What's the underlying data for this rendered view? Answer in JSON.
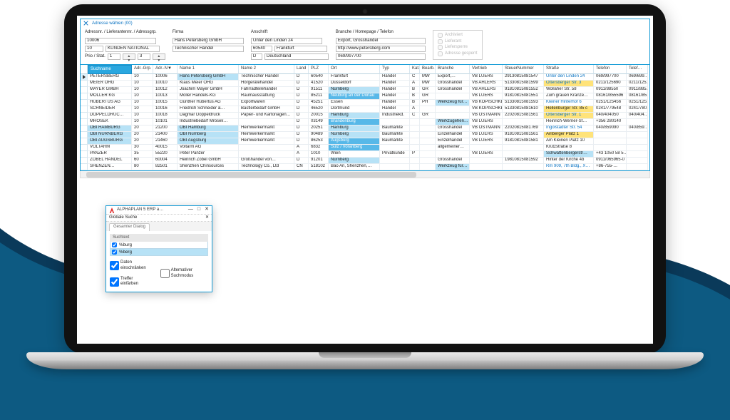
{
  "window": {
    "title": "Adresse wählen (00)"
  },
  "form": {
    "adr_label": "Adressnr. / Lieferantennr. / Adressgrp.",
    "adr_nr": "10006",
    "adr_grp_nr": "10",
    "adr_grp_name": "KUNDEN NATIONAL",
    "prio_label": "Prio / Stat.",
    "prio": "1",
    "stat": "3",
    "firma_label": "Firma",
    "firma1": "Hans Petersberg GmbH",
    "firma2": "Technischer Handel",
    "anschrift_label": "Anschrift",
    "street": "Unter den Linden 24",
    "plz": "60540",
    "ort": "Frankfurt",
    "land": "D",
    "land2": "Deutschland",
    "branche_label": "Branche / Homepage / Telefon",
    "branche": "Export, Grosshandel",
    "homepage": "http://www.petersberg.com",
    "tel": "069/997700",
    "chk_archiviert": "Archiviert",
    "chk_lieferant": "Lieferant",
    "chk_liefersperre": "Liefersperre",
    "chk_adressgesperrt": "Adresse gesperrt"
  },
  "grid": {
    "headers": {
      "suchname": "Suchname",
      "grp": "Adr.-Grp. ▲",
      "nr": "Adr.-N▼",
      "n1": "Name 1",
      "n2": "Name 2",
      "land": "Land",
      "plz": "PLZ",
      "ort": "Ort",
      "typ": "Typ",
      "kat": "Kat.",
      "bearb": "Bearb.",
      "branche": "Branche",
      "vertr": "Vertrieb",
      "steuer": "SteuerNummer",
      "str": "Straße",
      "tel": "Telefon",
      "tel2": "Telef…"
    },
    "rows": [
      {
        "such": "PETERSBERG",
        "grp": "10",
        "nr": "10006",
        "n1": "Hans Petersberg GmbH",
        "n2": "Technischer Handel",
        "land": "D",
        "plz": "60540",
        "ort": "Frankfurt",
        "typ": "Handel",
        "kat": "C",
        "bearb": "MW",
        "branche": "Export,…",
        "vertr": "VB LÜERS",
        "steuer": "29130815081547",
        "str": "Unter den Linden 24",
        "tel": "069/997700",
        "tel2": "069/699…",
        "sel": true,
        "hl_n1": "lt",
        "str_link": true
      },
      {
        "such": "MEIER OHG",
        "grp": "10",
        "nr": "10010",
        "n1": "Klaus Meier OHG",
        "n2": "Hörgerätehandel",
        "land": "D",
        "plz": "41520",
        "ort": "Düsseldorf",
        "typ": "Handel",
        "kat": "A",
        "bearb": "MW",
        "branche": "Grosshandel",
        "vertr": "VB AHLERS",
        "steuer": "51330815081599",
        "str": "Ottersberger Str. 3",
        "tel": "0211/125690",
        "tel2": "0211/125…",
        "hl_str": "yw",
        "str_link": true
      },
      {
        "such": "MAYER GMBH",
        "grp": "10",
        "nr": "10012",
        "n1": "Joachim Mayer GmbH",
        "n2": "Fahrradteilehandel",
        "land": "D",
        "plz": "91511",
        "ort": "Nürnberg",
        "typ": "Handel",
        "kat": "B",
        "bearb": "GR",
        "branche": "Grosshandel",
        "vertr": "VB AHLERS",
        "steuer": "91810815081552",
        "str": "Wollaher Str. 58",
        "tel": "0911/88550",
        "tel2": "0911/885…",
        "hl_ort": "lt"
      },
      {
        "such": "MOLLER KG",
        "grp": "10",
        "nr": "10013",
        "n1": "Moller Handels-KG",
        "n2": "Raumausstattung",
        "land": "D",
        "plz": "85211",
        "ort": "Neuburg an der Donau",
        "typ": "Handel",
        "kat": "B",
        "bearb": "GR",
        "branche": "",
        "vertr": "VB LÜERS",
        "steuer": "91810815081551",
        "str": "Zum grauen Kranze…",
        "tel": "08161/855596",
        "tel2": "08161/85…",
        "hl_ort": "dk"
      },
      {
        "such": "HUBERTUS AG",
        "grp": "10",
        "nr": "10015",
        "n1": "Günther Hubertus AG",
        "n2": "Exportwaren",
        "land": "D",
        "plz": "45251",
        "ort": "Essen",
        "typ": "Handel",
        "kat": "B",
        "bearb": "PH",
        "branche": "Werkzeug für…",
        "vertr": "VB KOPISCHKE",
        "steuer": "51330815081593",
        "str": "Kleiner Hinterhof 6",
        "tel": "0251/125456",
        "tel2": "0251/125…",
        "hl_branche": "lt",
        "str_link": true
      },
      {
        "such": "SCHNEIDER",
        "grp": "10",
        "nr": "10016",
        "n1": "Friedrich Schneider &…",
        "n2": "Bastlerbedarf GmbH",
        "land": "D",
        "plz": "46520",
        "ort": "Dortmund",
        "typ": "Handel",
        "kat": "A",
        "bearb": "",
        "branche": "",
        "vertr": "VB KOPISCHKE",
        "steuer": "51330815081610",
        "str": "Hellenburger Str. 85 c",
        "tel": "0241/779548",
        "tel2": "0241/780…",
        "hl_str": "yw"
      },
      {
        "such": "DOPPELDRUC…",
        "grp": "10",
        "nr": "10018",
        "n1": "Dagmar Doppeldruck",
        "n2": "Papier- und Kartonagen…",
        "land": "D",
        "plz": "20015",
        "ort": "Hamburg",
        "typ": "Industriekd.",
        "kat": "C",
        "bearb": "GR",
        "branche": "",
        "vertr": "VB OSTMANN",
        "steuer": "22020815081561",
        "str": "Ottersberger Str. 1",
        "tel": "040/404050",
        "tel2": "040/404…",
        "hl_ort": "lt",
        "hl_str": "yw",
        "str_link": true
      },
      {
        "such": "MROSEK",
        "grp": "10",
        "nr": "10101",
        "n1": "Industriebedarf Mrosek…",
        "n2": "",
        "land": "D",
        "plz": "03149",
        "ort": "Brandenburg",
        "typ": "",
        "kat": "",
        "bearb": "",
        "branche": "Werkzugehen…",
        "vertr": "VB LÜERS",
        "steuer": "",
        "str": "Heinrich-Werner-St…",
        "tel": "+356 280140",
        "tel2": "",
        "hl_ort": "dk",
        "hl_branche": "lt"
      },
      {
        "such": "OBI HAMBURG",
        "grp": "20",
        "nr": "21200",
        "n1": "OBI Hamburg",
        "n2": "Heimwerkermarkt",
        "land": "D",
        "plz": "20251",
        "ort": "Hamburg",
        "typ": "Baumärkte",
        "kat": "",
        "bearb": "",
        "branche": "Grosshandel",
        "vertr": "VB OSTMANN",
        "steuer": "22020815081769",
        "str": "Ingolstädter Str. 54",
        "tel": "040/859090",
        "tel2": "040/859…",
        "hl_such": "lt",
        "hl_n1": "lt",
        "hl_ort": "lt",
        "str_link": true
      },
      {
        "such": "OBI NÜRNBERG",
        "grp": "20",
        "nr": "21400",
        "n1": "OBI Nürnberg",
        "n2": "Heimwerkermarkt",
        "land": "D",
        "plz": "90489",
        "ort": "Nürnberg",
        "typ": "Baumärkte",
        "kat": "",
        "bearb": "",
        "branche": "Einzelhandel",
        "vertr": "VB LÜERS",
        "steuer": "91810815081561",
        "str": "Airiberger Platz 1",
        "tel": "",
        "tel2": "",
        "hl_such": "lt",
        "hl_n1": "lt",
        "hl_ort": "lt",
        "hl_str": "yw"
      },
      {
        "such": "OBI AUGSBURG",
        "grp": "20",
        "nr": "21460",
        "n1": "OBI Augsburg",
        "n2": "Heimwerkermarkt",
        "land": "D",
        "plz": "86253",
        "ort": "Augsburg",
        "typ": "Baumärkte",
        "kat": "",
        "bearb": "",
        "branche": "Einzelhandel",
        "vertr": "VB LÜERS",
        "steuer": "91810815081581",
        "str": "Am Kleinen Platz 10",
        "tel": "",
        "tel2": "",
        "hl_such": "lt",
        "hl_n1": "lt",
        "hl_ort": "dk"
      },
      {
        "such": "VOLTARM",
        "grp": "30",
        "nr": "40015",
        "n1": "Voltarm AG",
        "n2": "",
        "land": "A",
        "plz": "6832",
        "ort": "Sulz / Vorarlberg",
        "typ": "",
        "kat": "",
        "bearb": "",
        "branche": "allgemeiner…",
        "vertr": "",
        "steuer": "",
        "str": "Krutzstraße 8",
        "tel": "",
        "tel2": "",
        "hl_ort": "dk"
      },
      {
        "such": "PANZER",
        "grp": "35",
        "nr": "55220",
        "n1": "Peter Panzer",
        "n2": "",
        "land": "A",
        "plz": "1010",
        "ort": "Wien",
        "typ": "Privatkunde",
        "kat": "P",
        "bearb": "",
        "branche": "",
        "vertr": "VB LÜERS",
        "steuer": "",
        "str": "Schwattenbergerstr…",
        "tel": "+43 1050 58 5…",
        "tel2": "",
        "hl_str": "lt"
      },
      {
        "such": "ZOBEL HANDEL",
        "grp": "60",
        "nr": "60004",
        "n1": "Heinrich Zobel GmbH",
        "n2": "Großhandel von…",
        "land": "D",
        "plz": "91201",
        "ort": "Nürnberg",
        "typ": "",
        "kat": "",
        "bearb": "",
        "branche": "Grosshandel",
        "vertr": "",
        "steuer": "19810815081592",
        "str": "Hinter der Kirche 4b",
        "tel": "0911/065965-0",
        "tel2": "",
        "hl_ort": "lt"
      },
      {
        "such": "SHENZEN…",
        "grp": "80",
        "nr": "82501",
        "n1": "Shenzhen Chinsources",
        "n2": "Technology Co., Ltd",
        "land": "CN",
        "plz": "518102",
        "ort": "Bao An, Shenzhen,…",
        "typ": "",
        "kat": "",
        "bearb": "",
        "branche": "Werkzeug für…",
        "vertr": "",
        "steuer": "",
        "str": "Rm 909, 7th Bldg., X…",
        "tel": "+86-755-…",
        "tel2": "",
        "hl_branche": "lt",
        "str_link": true
      }
    ]
  },
  "popup": {
    "title": "ALPHAPLAN 5 ERP a…",
    "section": "Globale Suche",
    "tab": "Gesamter Dialog",
    "col_header": "Suchtext",
    "terms": [
      "%burg",
      "%berg"
    ],
    "opt_daten": "Daten einschränken",
    "opt_alt": "Alternativer Suchmodus",
    "opt_treffer": "Treffer einfärben"
  }
}
